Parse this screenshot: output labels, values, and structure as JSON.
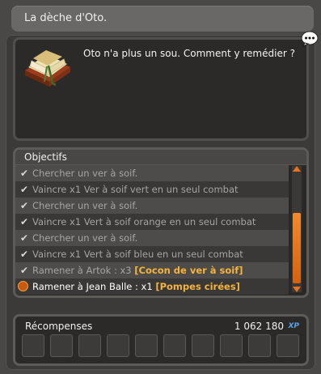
{
  "window": {
    "title": "La dèche d'Oto."
  },
  "dialog": {
    "text": "Oto n'a plus un sou. Comment y remédier ?",
    "icon": "quest-book-icon"
  },
  "objectives": {
    "header": "Objectifs",
    "items": [
      {
        "text": "Chercher un ver à soif.",
        "status": "done"
      },
      {
        "text": "Vaincre x1 Ver à soif vert en un seul combat",
        "status": "done"
      },
      {
        "text": "Chercher un ver à soif.",
        "status": "done"
      },
      {
        "text": "Vaincre x1 Vert à soif orange en un seul combat",
        "status": "done"
      },
      {
        "text": "Chercher un ver à soif.",
        "status": "done"
      },
      {
        "text": "Vaincre x1 Vert à soif bleu en un seul combat",
        "status": "done"
      },
      {
        "text": "Ramener à Artok : x3 ",
        "highlight": "[Cocon de ver à soif]",
        "status": "done"
      },
      {
        "text": "Ramener à Jean Balle : x1 ",
        "highlight": "[Pompes cirées]",
        "status": "active"
      }
    ]
  },
  "rewards": {
    "label": "Récompenses",
    "xp": "1 062 180",
    "xp_unit": "XP",
    "slot_count": 10
  },
  "colors": {
    "accent": "#e8731c",
    "highlight": "#f6b33a",
    "xp": "#5aa0e8"
  }
}
